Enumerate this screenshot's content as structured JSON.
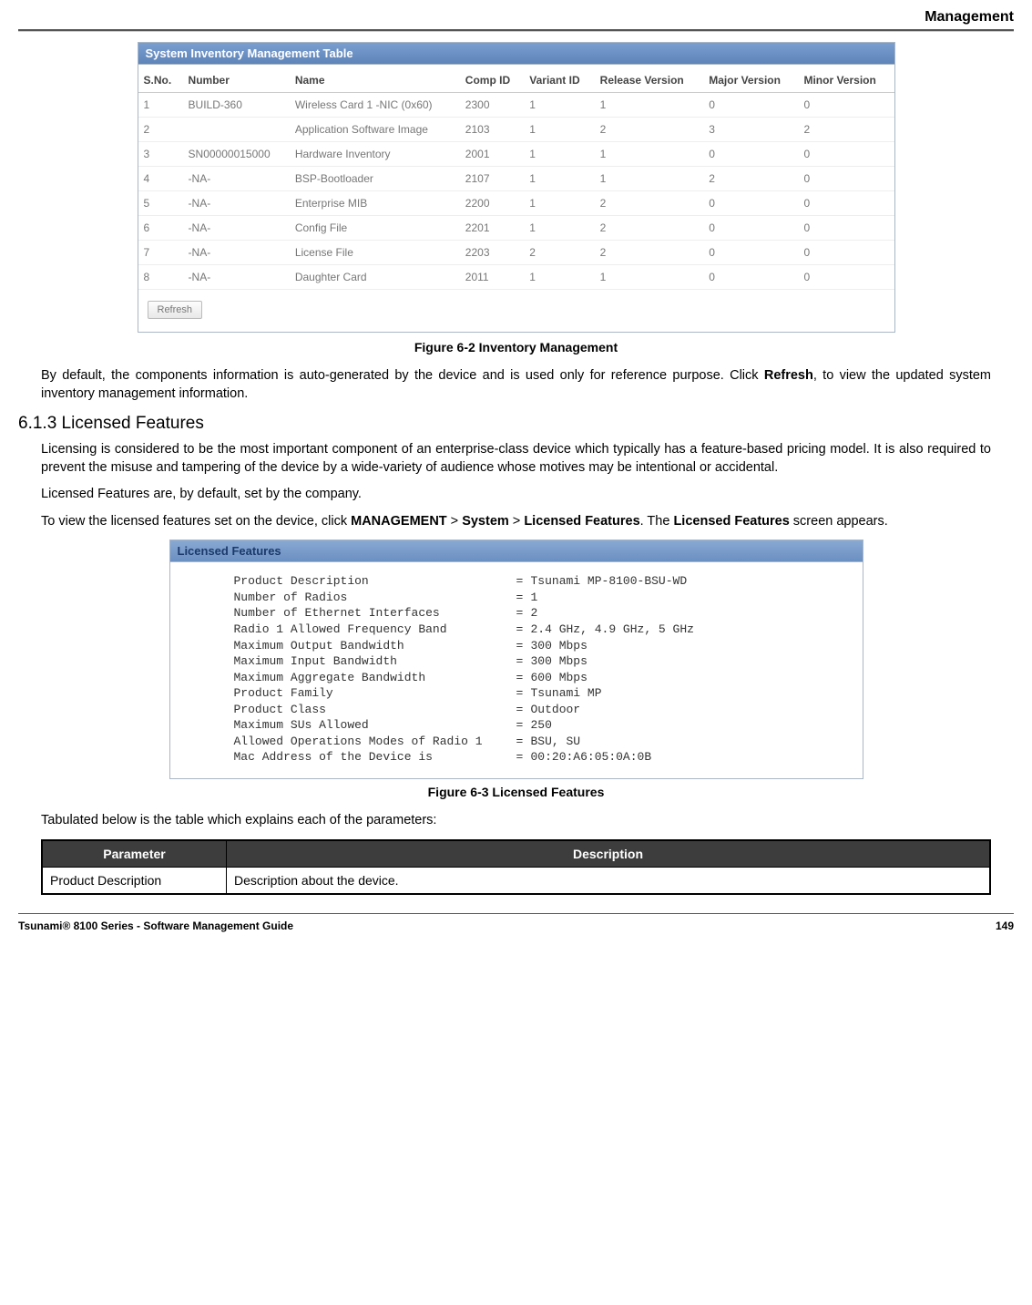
{
  "header": {
    "title": "Management"
  },
  "inventory_panel": {
    "title": "System Inventory Management Table",
    "columns": [
      "S.No.",
      "Number",
      "Name",
      "Comp ID",
      "Variant ID",
      "Release Version",
      "Major Version",
      "Minor Version"
    ],
    "rows": [
      {
        "sno": "1",
        "number": "BUILD-360",
        "name": "Wireless Card 1 -NIC (0x60)",
        "comp": "2300",
        "variant": "1",
        "release": "1",
        "major": "0",
        "minor": "0"
      },
      {
        "sno": "2",
        "number": "",
        "name": "Application Software Image",
        "comp": "2103",
        "variant": "1",
        "release": "2",
        "major": "3",
        "minor": "2"
      },
      {
        "sno": "3",
        "number": "SN00000015000",
        "name": "Hardware Inventory",
        "comp": "2001",
        "variant": "1",
        "release": "1",
        "major": "0",
        "minor": "0"
      },
      {
        "sno": "4",
        "number": "-NA-",
        "name": "BSP-Bootloader",
        "comp": "2107",
        "variant": "1",
        "release": "1",
        "major": "2",
        "minor": "0"
      },
      {
        "sno": "5",
        "number": "-NA-",
        "name": "Enterprise MIB",
        "comp": "2200",
        "variant": "1",
        "release": "2",
        "major": "0",
        "minor": "0"
      },
      {
        "sno": "6",
        "number": "-NA-",
        "name": "Config File",
        "comp": "2201",
        "variant": "1",
        "release": "2",
        "major": "0",
        "minor": "0"
      },
      {
        "sno": "7",
        "number": "-NA-",
        "name": "License File",
        "comp": "2203",
        "variant": "2",
        "release": "2",
        "major": "0",
        "minor": "0"
      },
      {
        "sno": "8",
        "number": "-NA-",
        "name": "Daughter Card",
        "comp": "2011",
        "variant": "1",
        "release": "1",
        "major": "0",
        "minor": "0"
      }
    ],
    "refresh_label": "Refresh"
  },
  "captions": {
    "fig62": "Figure 6-2 Inventory Management",
    "fig63": "Figure 6-3 Licensed Features"
  },
  "paragraphs": {
    "p1a": "By default, the components information is auto-generated by the device and is used only for reference purpose. Click",
    "p1b_bold": "Refresh",
    "p1c": ", to view the updated system inventory management information.",
    "section_title": "6.1.3 Licensed Features",
    "p2": "Licensing is considered to be the most important component of an enterprise-class device which typically has a feature-based pricing model. It is also required to prevent the misuse and tampering of the device by a wide-variety of audience whose motives may be intentional or accidental.",
    "p3": "Licensed Features are, by default, set by the company.",
    "p4a": "To view the licensed features set on the device, click ",
    "p4_mgmt": "MANAGEMENT",
    "p4_gt1": " > ",
    "p4_sys": "System",
    "p4_gt2": " > ",
    "p4_lf": "Licensed Features",
    "p4b": ". The ",
    "p4_lf2": "Licensed Features",
    "p4c": " screen appears.",
    "p5": "Tabulated below is the table which explains each of the parameters:"
  },
  "licensed_panel": {
    "title": "Licensed Features",
    "rows": [
      {
        "label": "Product Description",
        "value": "Tsunami MP-8100-BSU-WD"
      },
      {
        "label": "Number of Radios",
        "value": "1"
      },
      {
        "label": "Number of Ethernet Interfaces",
        "value": "2"
      },
      {
        "label": "Radio 1 Allowed Frequency Band",
        "value": "2.4 GHz, 4.9 GHz, 5 GHz"
      },
      {
        "label": "Maximum Output Bandwidth",
        "value": "300 Mbps"
      },
      {
        "label": "Maximum Input Bandwidth",
        "value": "300 Mbps"
      },
      {
        "label": "Maximum Aggregate Bandwidth",
        "value": "600 Mbps"
      },
      {
        "label": "Product Family",
        "value": "Tsunami MP"
      },
      {
        "label": "Product Class",
        "value": "Outdoor"
      },
      {
        "label": "Maximum SUs Allowed",
        "value": "250"
      },
      {
        "label": "Allowed Operations Modes of Radio 1",
        "value": "BSU, SU"
      },
      {
        "label": "Mac Address of the Device is",
        "value": "00:20:A6:05:0A:0B"
      }
    ]
  },
  "param_table": {
    "headers": [
      "Parameter",
      "Description"
    ],
    "rows": [
      {
        "param": "Product Description",
        "desc": "Description about the device."
      }
    ]
  },
  "footer": {
    "left": "Tsunami® 8100 Series - Software Management Guide",
    "right": "149"
  }
}
